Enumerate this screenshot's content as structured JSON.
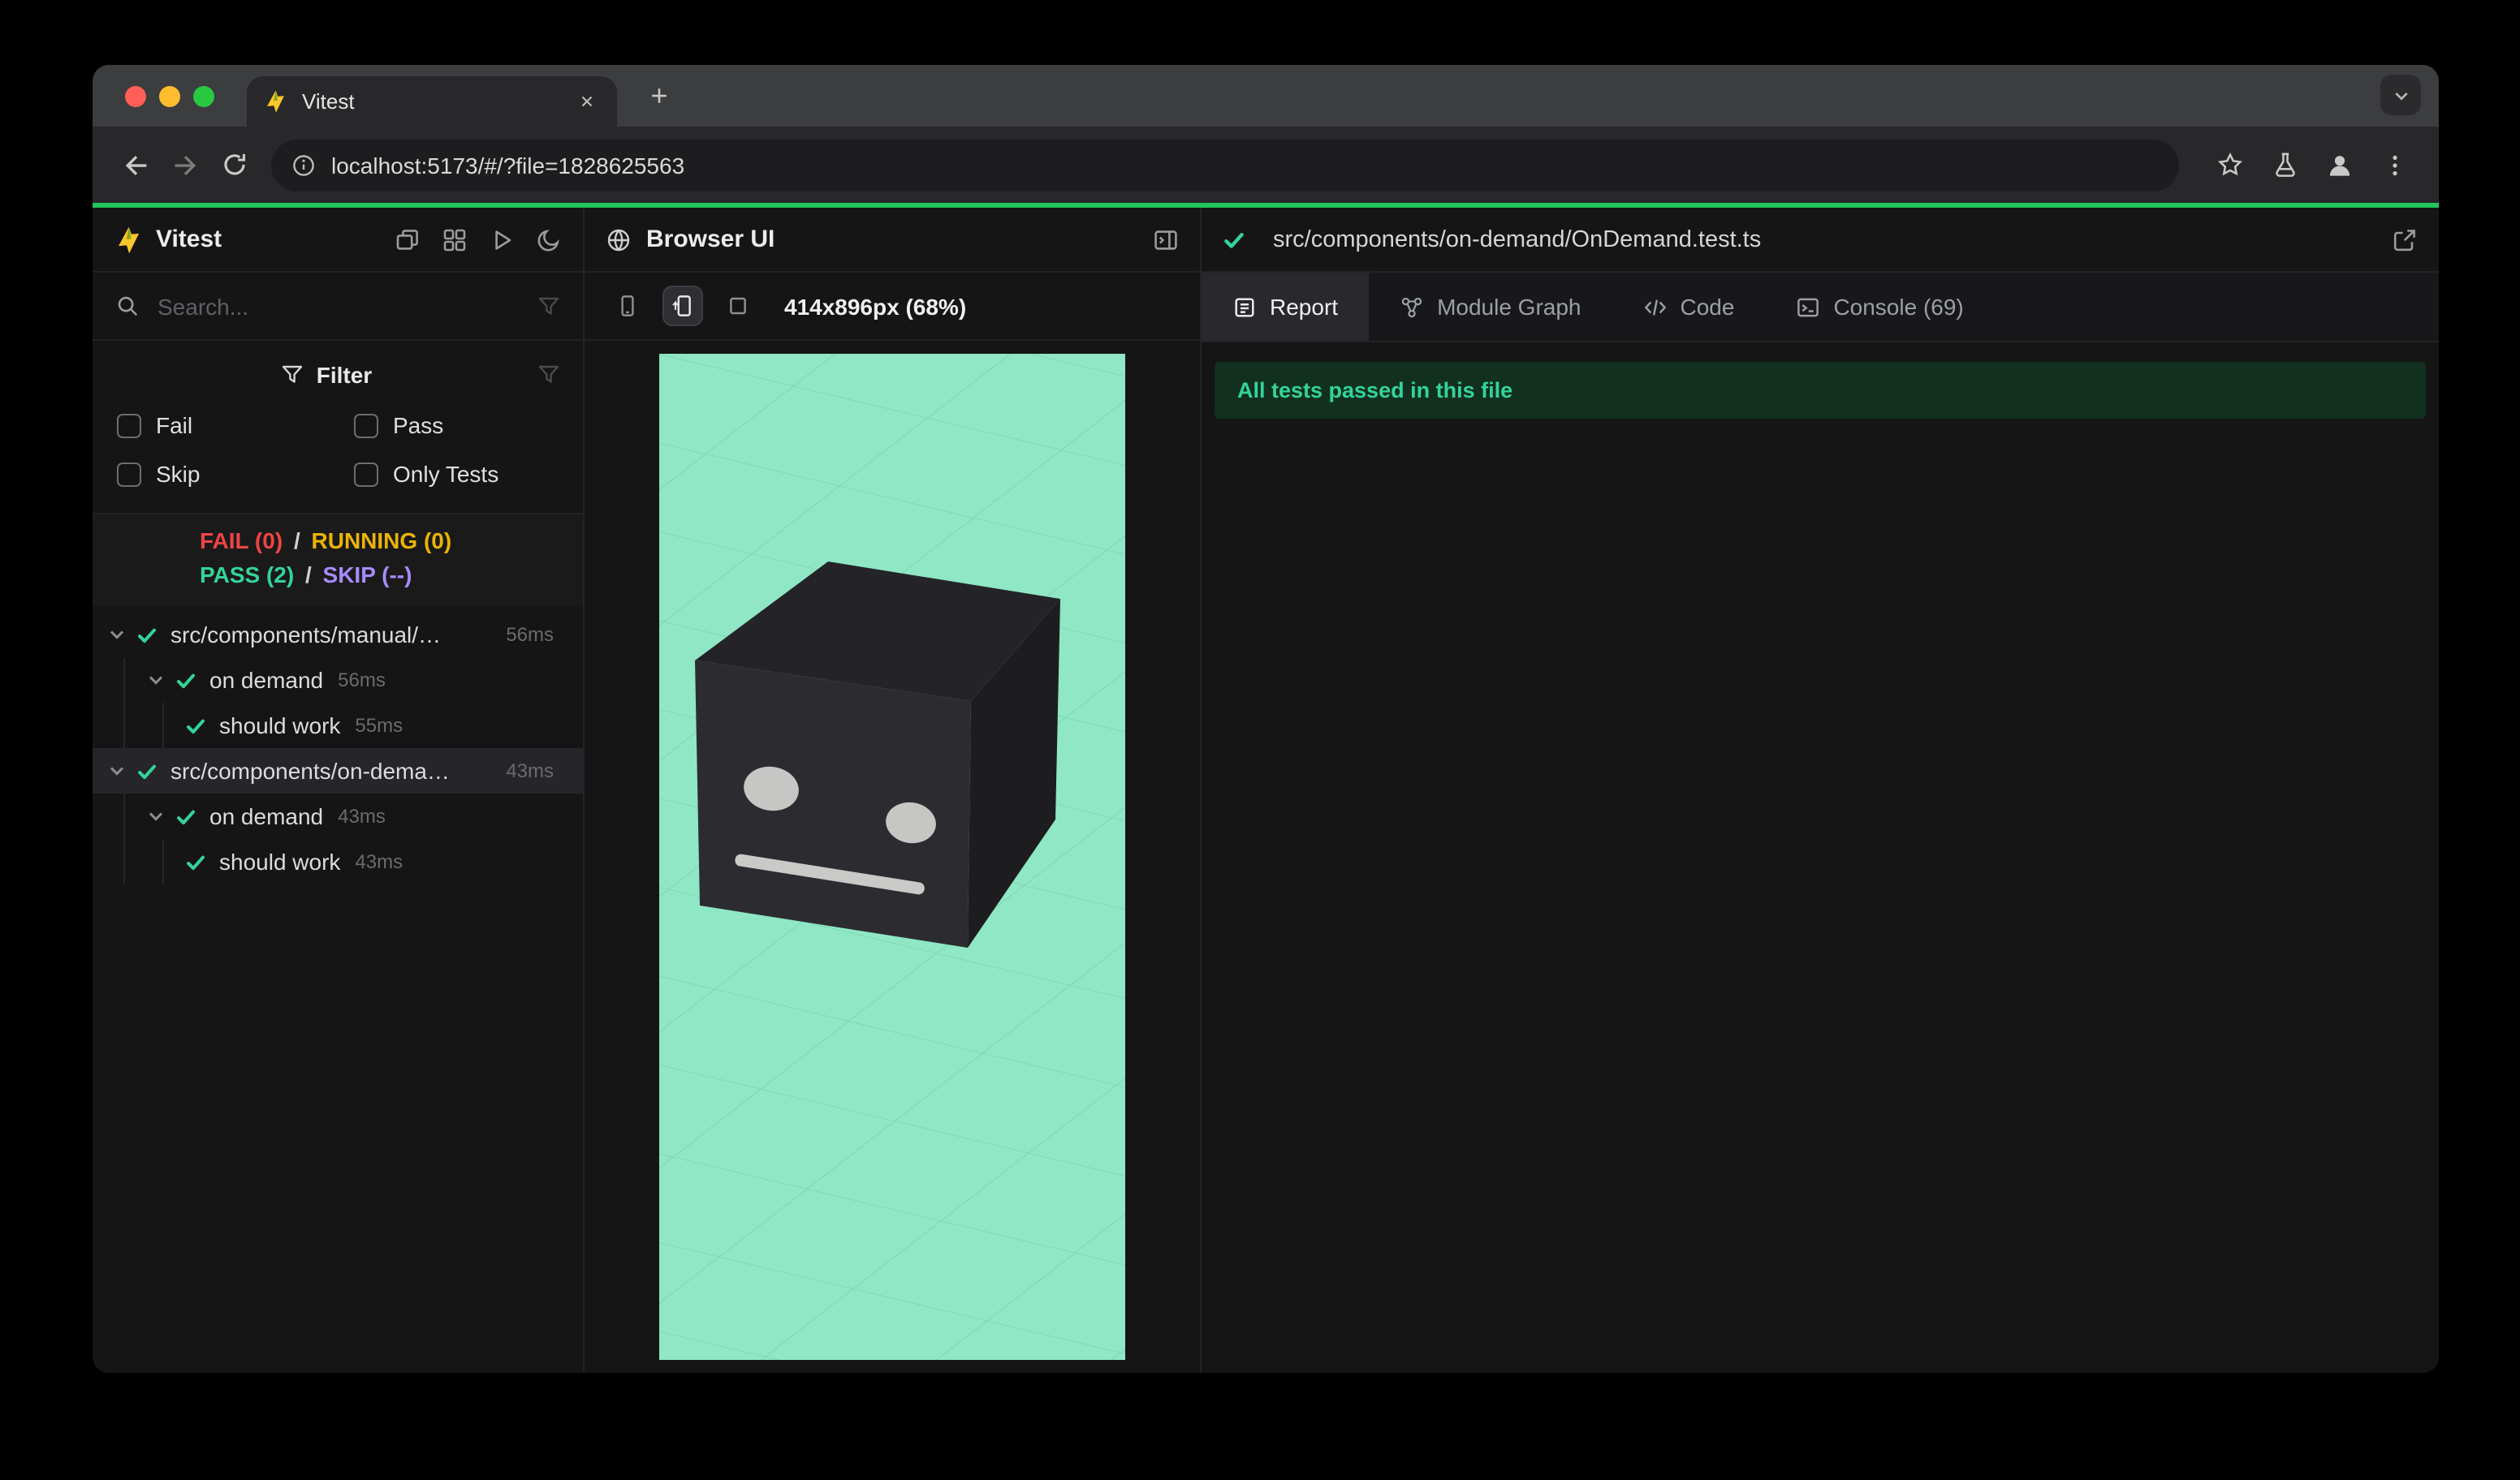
{
  "chrome": {
    "tab": {
      "title": "Vitest"
    },
    "url": "localhost:5173/#/?file=1828625563"
  },
  "vitest": {
    "app_title": "Vitest",
    "search_placeholder": "Search...",
    "filter": {
      "title": "Filter",
      "options": [
        {
          "label": "Fail",
          "checked": false
        },
        {
          "label": "Pass",
          "checked": false
        },
        {
          "label": "Skip",
          "checked": false
        },
        {
          "label": "Only Tests",
          "checked": false
        }
      ]
    },
    "summary": {
      "fail": "FAIL (0)",
      "sep1": "/",
      "running": "RUNNING (0)",
      "pass": "PASS (2)",
      "sep2": "/",
      "skip": "SKIP (--)"
    },
    "tree": [
      {
        "label": "src/components/manual/…",
        "duration": "56ms",
        "level": 0,
        "type": "file",
        "selected": false
      },
      {
        "label": "on demand",
        "duration": "56ms",
        "level": 1,
        "type": "suite",
        "selected": false
      },
      {
        "label": "should work",
        "duration": "55ms",
        "level": 2,
        "type": "test",
        "selected": false
      },
      {
        "label": "src/components/on-dema…",
        "duration": "43ms",
        "level": 0,
        "type": "file",
        "selected": true
      },
      {
        "label": "on demand",
        "duration": "43ms",
        "level": 1,
        "type": "suite",
        "selected": false
      },
      {
        "label": "should work",
        "duration": "43ms",
        "level": 2,
        "type": "test",
        "selected": false
      }
    ]
  },
  "browser_ui": {
    "title": "Browser UI",
    "viewport_label": "414x896px (68%)"
  },
  "report": {
    "file_path": "src/components/on-demand/OnDemand.test.ts",
    "tabs": [
      {
        "label": "Report",
        "icon": "report-icon",
        "active": true
      },
      {
        "label": "Module Graph",
        "icon": "module-graph-icon",
        "active": false
      },
      {
        "label": "Code",
        "icon": "code-icon",
        "active": false
      },
      {
        "label": "Console (69)",
        "icon": "console-icon",
        "active": false
      }
    ],
    "banner": "All tests passed in this file"
  },
  "colors": {
    "accent_green": "#22c55e",
    "pass": "#34d399",
    "fail": "#ef4444",
    "running": "#eab308",
    "skip": "#a78bfa",
    "canvas": "#8fe7c5"
  }
}
